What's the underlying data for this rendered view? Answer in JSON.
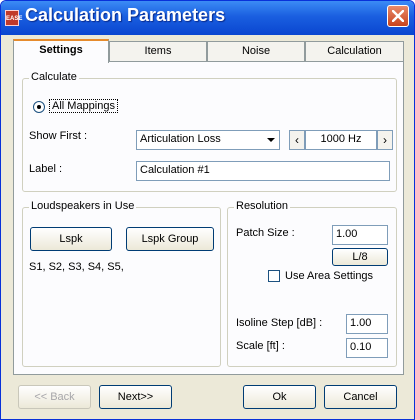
{
  "window": {
    "title": "Calculation Parameters",
    "logo_text": "EASE"
  },
  "tabs": [
    {
      "label": "Settings",
      "active": true
    },
    {
      "label": "Items",
      "active": false
    },
    {
      "label": "Noise",
      "active": false
    },
    {
      "label": "Calculation",
      "active": false
    }
  ],
  "calculate": {
    "group_label": "Calculate",
    "all_mappings_label": "All Mappings",
    "show_first_label": "Show First :",
    "show_first_value": "Articulation Loss",
    "frequency_value": "1000 Hz",
    "label_label": "Label :",
    "label_value": "Calculation #1"
  },
  "loudspeakers": {
    "group_label": "Loudspeakers in Use",
    "lspk_button": "Lspk",
    "lspk_group_button": "Lspk Group",
    "list_text": "S1, S2, S3, S4, S5,"
  },
  "resolution": {
    "group_label": "Resolution",
    "patch_size_label": "Patch Size :",
    "patch_size_value": "1.00",
    "l8_button": "L/8",
    "use_area_settings_label": "Use Area Settings",
    "isoline_label": "Isoline Step [dB] :",
    "isoline_value": "1.00",
    "scale_label": "Scale [ft] :",
    "scale_value": "0.10"
  },
  "footer": {
    "back_label": "<< Back",
    "next_label": "Next>>",
    "ok_label": "Ok",
    "cancel_label": "Cancel"
  },
  "icons": {
    "close": "close-icon",
    "dropdown": "chevron-down-icon",
    "spin_left": "chevron-left-icon",
    "spin_right": "chevron-right-icon"
  }
}
